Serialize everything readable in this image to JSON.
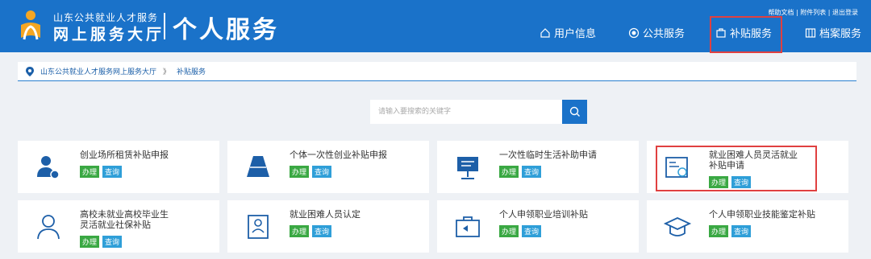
{
  "header": {
    "brand_top": "山东公共就业人才服务",
    "brand_bottom": "网上服务大厅",
    "section_title": "个人服务",
    "top_links": [
      "帮助文档",
      "附件列表",
      "退出登录"
    ],
    "nav": [
      {
        "label": "用户信息",
        "icon": "home-icon"
      },
      {
        "label": "公共服务",
        "icon": "circle-icon"
      },
      {
        "label": "补贴服务",
        "icon": "bag-icon"
      },
      {
        "label": "档案服务",
        "icon": "archive-icon"
      }
    ]
  },
  "breadcrumb": {
    "items": [
      "山东公共就业人才服务网上服务大厅",
      "补贴服务"
    ],
    "separator": "》"
  },
  "search": {
    "placeholder": "请输入要搜索的关键字"
  },
  "actions": {
    "do_label": "办理",
    "query_label": "查询"
  },
  "cards": [
    {
      "title": "创业场所租赁补贴申报",
      "icon": "person-icon"
    },
    {
      "title": "个体一次性创业补贴申报",
      "icon": "funnel-icon"
    },
    {
      "title": "一次性临时生活补助申请",
      "icon": "presentation-icon"
    },
    {
      "title": "就业困难人员灵活就业补贴申请",
      "icon": "form-icon"
    },
    {
      "title": "高校未就业高校毕业生灵活就业社保补贴",
      "icon": "user-outline-icon"
    },
    {
      "title": "就业困难人员认定",
      "icon": "id-card-icon"
    },
    {
      "title": "个人申领职业培训补贴",
      "icon": "briefcase-icon"
    },
    {
      "title": "个人申领职业技能鉴定补贴",
      "icon": "graduation-icon"
    }
  ],
  "colors": {
    "brand_blue": "#1a72c9",
    "do_green": "#3aa843",
    "query_blue": "#2f9fd8",
    "highlight_red": "#e04040"
  }
}
